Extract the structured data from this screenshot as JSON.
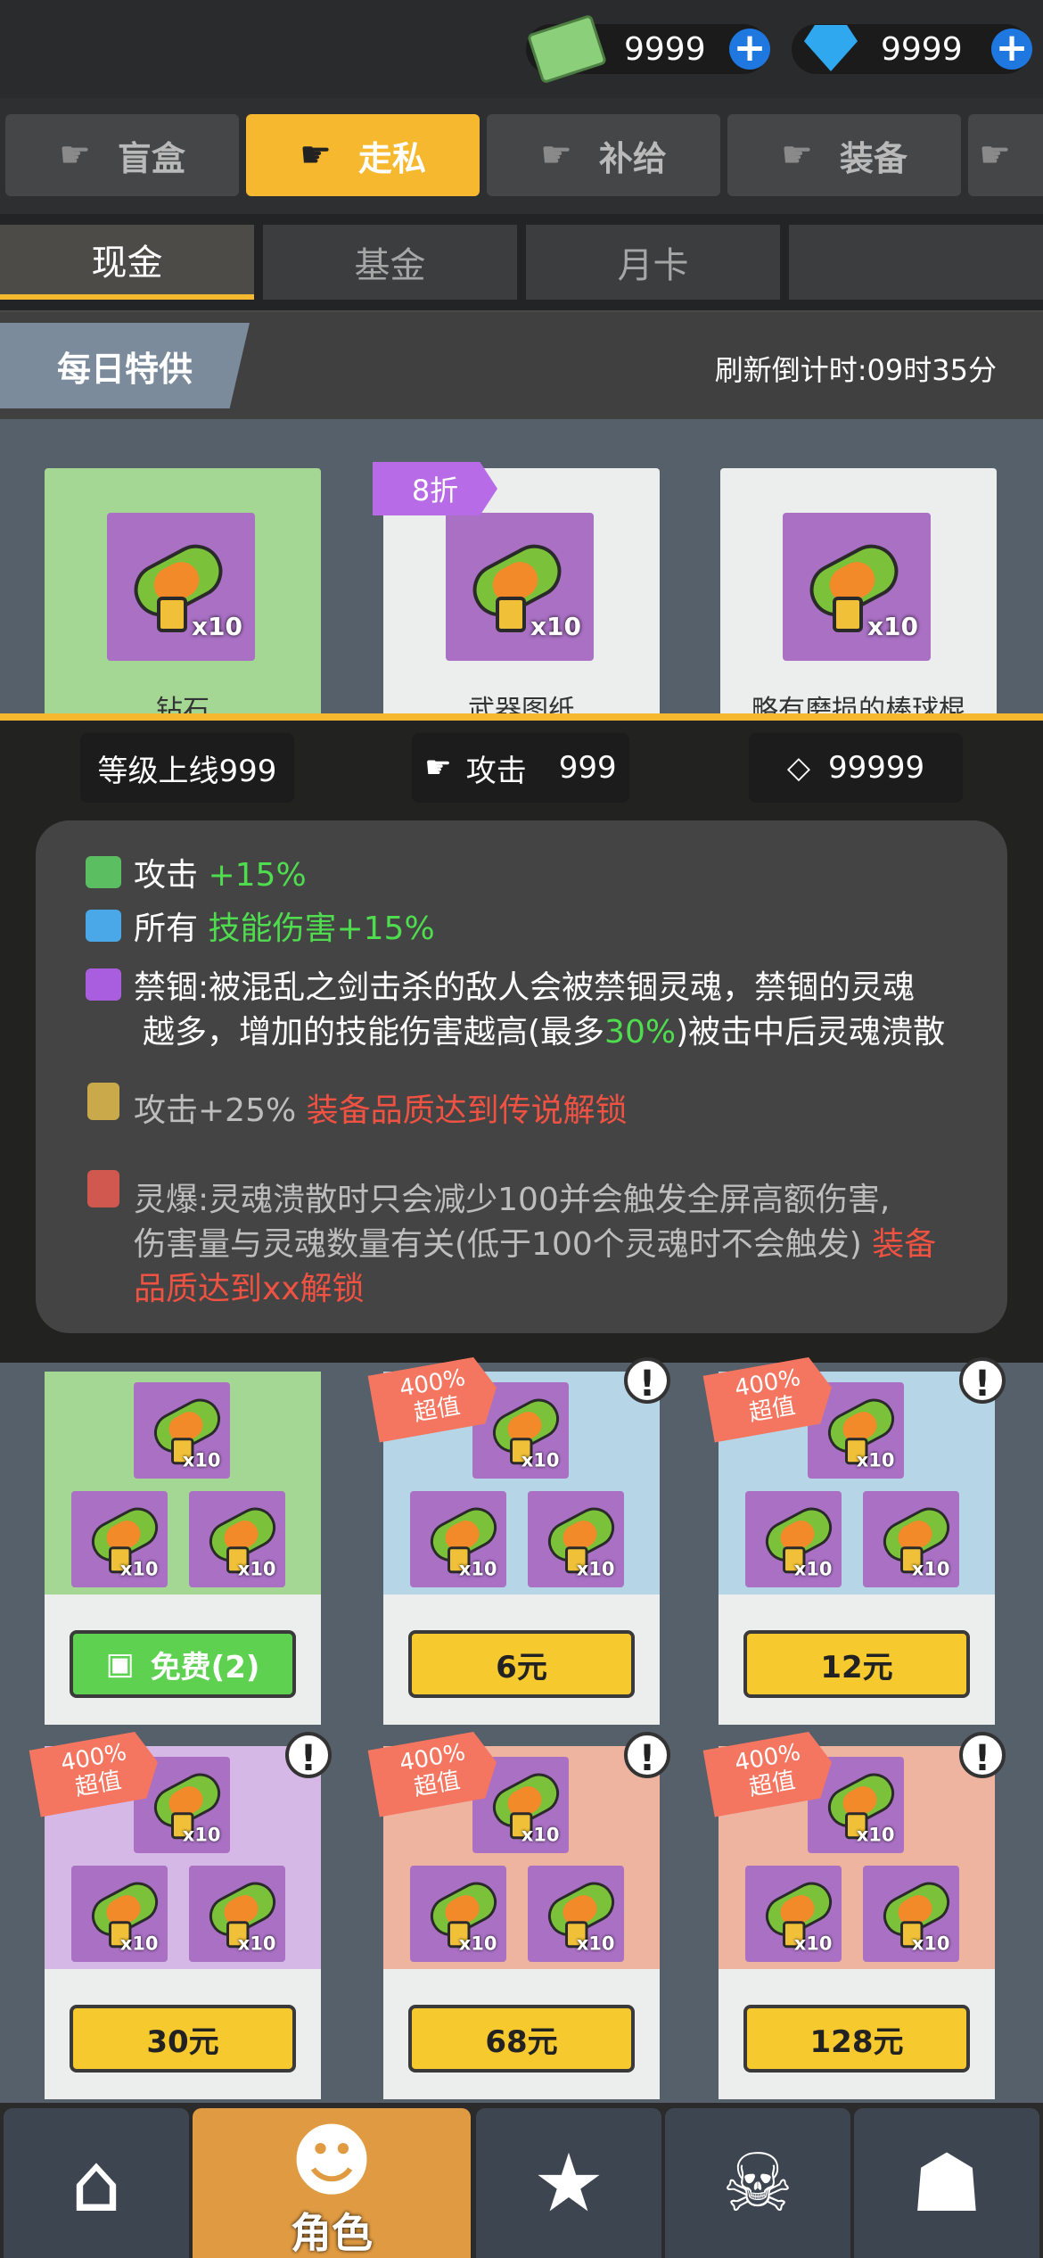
{
  "currency": {
    "cash": {
      "icon": "cash-stack-icon",
      "value": "9999"
    },
    "gems": {
      "icon": "diamond-icon",
      "value": "9999"
    }
  },
  "category_tabs": [
    {
      "label": "盲盒",
      "active": false
    },
    {
      "label": "走私",
      "active": true
    },
    {
      "label": "补给",
      "active": false
    },
    {
      "label": "装备",
      "active": false
    }
  ],
  "sub_tabs": [
    {
      "label": "现金",
      "active": true
    },
    {
      "label": "基金",
      "active": false
    },
    {
      "label": "月卡",
      "active": false
    }
  ],
  "daily": {
    "badge": "每日特供",
    "refresh": "刷新倒计时:09时35分",
    "discount_tag": "8折",
    "cards": [
      {
        "name": "钻石",
        "count": "x10"
      },
      {
        "name": "武器图纸",
        "count": "x10"
      },
      {
        "name": "略有磨损的棒球棍",
        "count": "x10"
      }
    ]
  },
  "stats": {
    "level_cap": "等级上线999",
    "attack_label": "攻击",
    "attack_value": "999",
    "gem_value": "99999"
  },
  "tooltip": {
    "line1_label": "攻击",
    "line1_value": "+15%",
    "line2_label": "所有",
    "line2_value": "技能伤害+15%",
    "line3a": "禁锢:被混乱之剑击杀的敌人会被禁锢灵魂，禁锢的灵魂",
    "line3b_pre": "越多，增加的技能伤害越高(最多",
    "line3b_hl": "30%",
    "line3b_post": ")被击中后灵魂溃散",
    "line4_text": "攻击+25%",
    "line4_lock": "装备品质达到传说解锁",
    "line5a": "灵爆:灵魂溃散时只会减少100并会触发全屏高额伤害,",
    "line5b": "伤害量与灵魂数量有关(低于100个灵魂时不会触发)",
    "line5b_lock": "装备",
    "line5c_lock": "品质达到xx解锁"
  },
  "packs": [
    {
      "color": "green",
      "price": "免费(2)",
      "tag": "",
      "free": true
    },
    {
      "color": "blue",
      "price": "6元",
      "tag": "400%超值"
    },
    {
      "color": "blue",
      "price": "12元",
      "tag": "400%超值"
    },
    {
      "color": "purple",
      "price": "30元",
      "tag": "400%超值"
    },
    {
      "color": "orange",
      "price": "68元",
      "tag": "400%超值"
    },
    {
      "color": "orange",
      "price": "128元",
      "tag": "400%超值"
    }
  ],
  "pack_count": "x10",
  "tag_line1": "400%",
  "tag_line2": "超值",
  "nav": {
    "active_label": "角色"
  }
}
